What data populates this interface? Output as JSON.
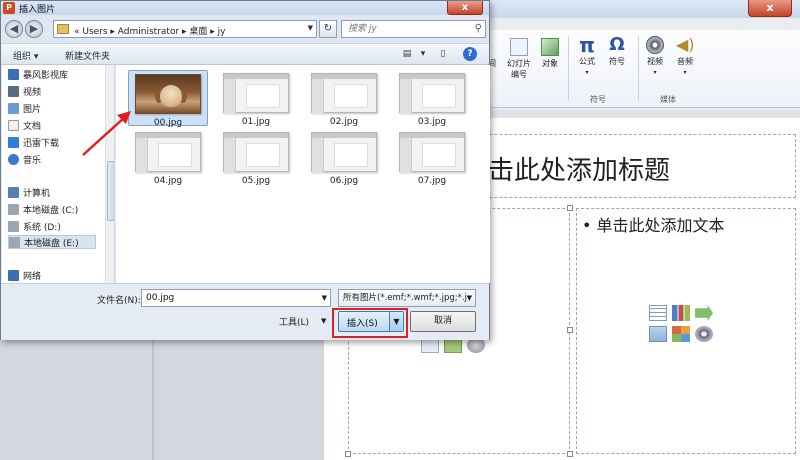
{
  "dialog": {
    "title": "插入图片",
    "close_label": "x",
    "address": {
      "path": "«  Users  ▸  Administrator  ▸  桌面  ▸  jy"
    },
    "search": {
      "placeholder": "搜索 jy"
    },
    "toolbar": {
      "organize": "组织 ▾",
      "new_folder": "新建文件夹",
      "help": "?"
    },
    "nav_items": [
      {
        "label": "暴风影视库",
        "icon": "video-library-icon"
      },
      {
        "label": "视频",
        "icon": "video-icon"
      },
      {
        "label": "图片",
        "icon": "pictures-icon"
      },
      {
        "label": "文档",
        "icon": "documents-icon"
      },
      {
        "label": "迅雷下载",
        "icon": "download-icon"
      },
      {
        "label": "音乐",
        "icon": "music-icon"
      },
      {
        "label": "计算机",
        "icon": "computer-icon"
      },
      {
        "label": "本地磁盘 (C:)",
        "icon": "drive-icon"
      },
      {
        "label": "系统 (D:)",
        "icon": "drive-icon"
      },
      {
        "label": "本地磁盘 (E:)",
        "icon": "drive-icon"
      },
      {
        "label": "网络",
        "icon": "network-icon"
      }
    ],
    "files": [
      {
        "name": "00.jpg",
        "selected": true
      },
      {
        "name": "01.jpg"
      },
      {
        "name": "02.jpg"
      },
      {
        "name": "03.jpg"
      },
      {
        "name": "04.jpg"
      },
      {
        "name": "05.jpg"
      },
      {
        "name": "06.jpg"
      },
      {
        "name": "07.jpg"
      }
    ],
    "filename_label": "文件名(N):",
    "filename_value": "00.jpg",
    "filter_value": "所有图片(*.emf;*.wmf;*.jpg;*.j",
    "tools_label": "工具(L)",
    "insert_label": "插入(S)",
    "cancel_label": "取消",
    "highlight_color": "#e02020",
    "arrow_color": "#e02020"
  },
  "ppt": {
    "close_label": "x",
    "ribbon": {
      "buttons": [
        {
          "label": "间",
          "icon": "partial-button-icon"
        },
        {
          "label": "幻灯片\n编号",
          "icon": "slide-number-icon"
        },
        {
          "label": "对象",
          "icon": "object-icon"
        },
        {
          "label": "公式",
          "icon": "equation-icon"
        },
        {
          "label": "符号",
          "icon": "symbol-icon"
        },
        {
          "label": "视频",
          "icon": "video-icon"
        },
        {
          "label": "音频",
          "icon": "audio-icon"
        }
      ],
      "groups": [
        "符号",
        "媒体"
      ]
    },
    "slide": {
      "title_placeholder": "击此处添加标题",
      "body_placeholder": "• 单击此处添加文本"
    }
  }
}
